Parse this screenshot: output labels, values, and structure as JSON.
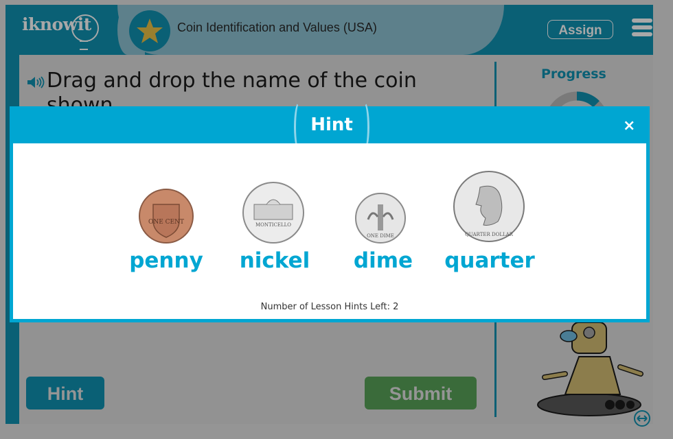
{
  "header": {
    "logo_text": "iknowit",
    "lesson_title": "Coin Identification and Values (USA)",
    "assign_label": "Assign",
    "menu_icon": "hamburger-menu-icon",
    "badge_icon": "star-icon"
  },
  "question": {
    "speaker_icon": "speaker-icon",
    "text": "Drag and drop the name of the coin shown."
  },
  "progress": {
    "label": "Progress",
    "fraction": 0.125
  },
  "buttons": {
    "hint_label": "Hint",
    "submit_label": "Submit"
  },
  "modal": {
    "title": "Hint",
    "close_label": "×",
    "coins": [
      {
        "name": "penny",
        "label": "penny",
        "color": "#c8896a",
        "inscription": "ONE CENT"
      },
      {
        "name": "nickel",
        "label": "nickel",
        "color": "#d8d8d8",
        "inscription": "MONTICELLO"
      },
      {
        "name": "dime",
        "label": "dime",
        "color": "#d0d0d0",
        "inscription": "ONE DIME"
      },
      {
        "name": "quarter",
        "label": "quarter",
        "color": "#cfcfcf",
        "inscription": "QUARTER DOLLAR"
      }
    ],
    "hints_left_text": "Number of Lesson Hints Left: 2"
  },
  "colors": {
    "brand": "#0a6075",
    "modal_accent": "#00a6d2",
    "submit": "#3a6b3a",
    "star": "#9a7f2e"
  }
}
